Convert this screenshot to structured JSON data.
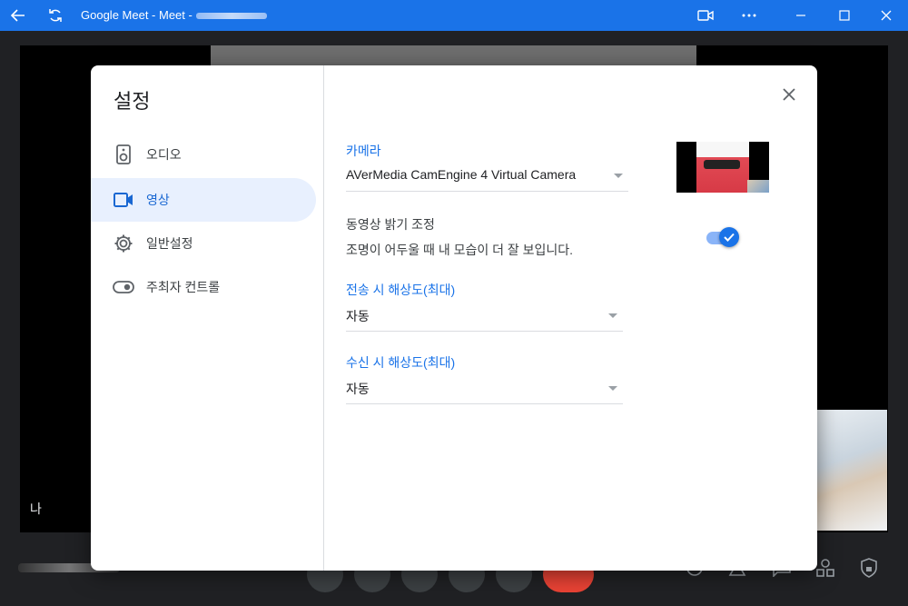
{
  "window": {
    "title": "Google Meet - Meet -"
  },
  "stage": {
    "self_label": "나"
  },
  "settings": {
    "title": "설정",
    "nav": [
      {
        "label": "오디오",
        "icon": "speaker-icon",
        "active": false
      },
      {
        "label": "영상",
        "icon": "videocam-icon",
        "active": true
      },
      {
        "label": "일반설정",
        "icon": "gear-icon",
        "active": false
      },
      {
        "label": "주최자 컨트롤",
        "icon": "toggle-icon",
        "active": false
      }
    ],
    "camera": {
      "label": "카메라",
      "value": "AVerMedia CamEngine 4 Virtual Camera"
    },
    "brightness": {
      "title": "동영상 밝기 조정",
      "description": "조명이 어두울 때 내 모습이 더 잘 보입니다.",
      "enabled": true
    },
    "send_resolution": {
      "label": "전송 시 해상도(최대)",
      "value": "자동"
    },
    "receive_resolution": {
      "label": "수신 시 해상도(최대)",
      "value": "자동"
    }
  },
  "colors": {
    "accent": "#1a73e8",
    "active_bg": "#e8f0fe",
    "titlebar": "#1a73e8"
  }
}
